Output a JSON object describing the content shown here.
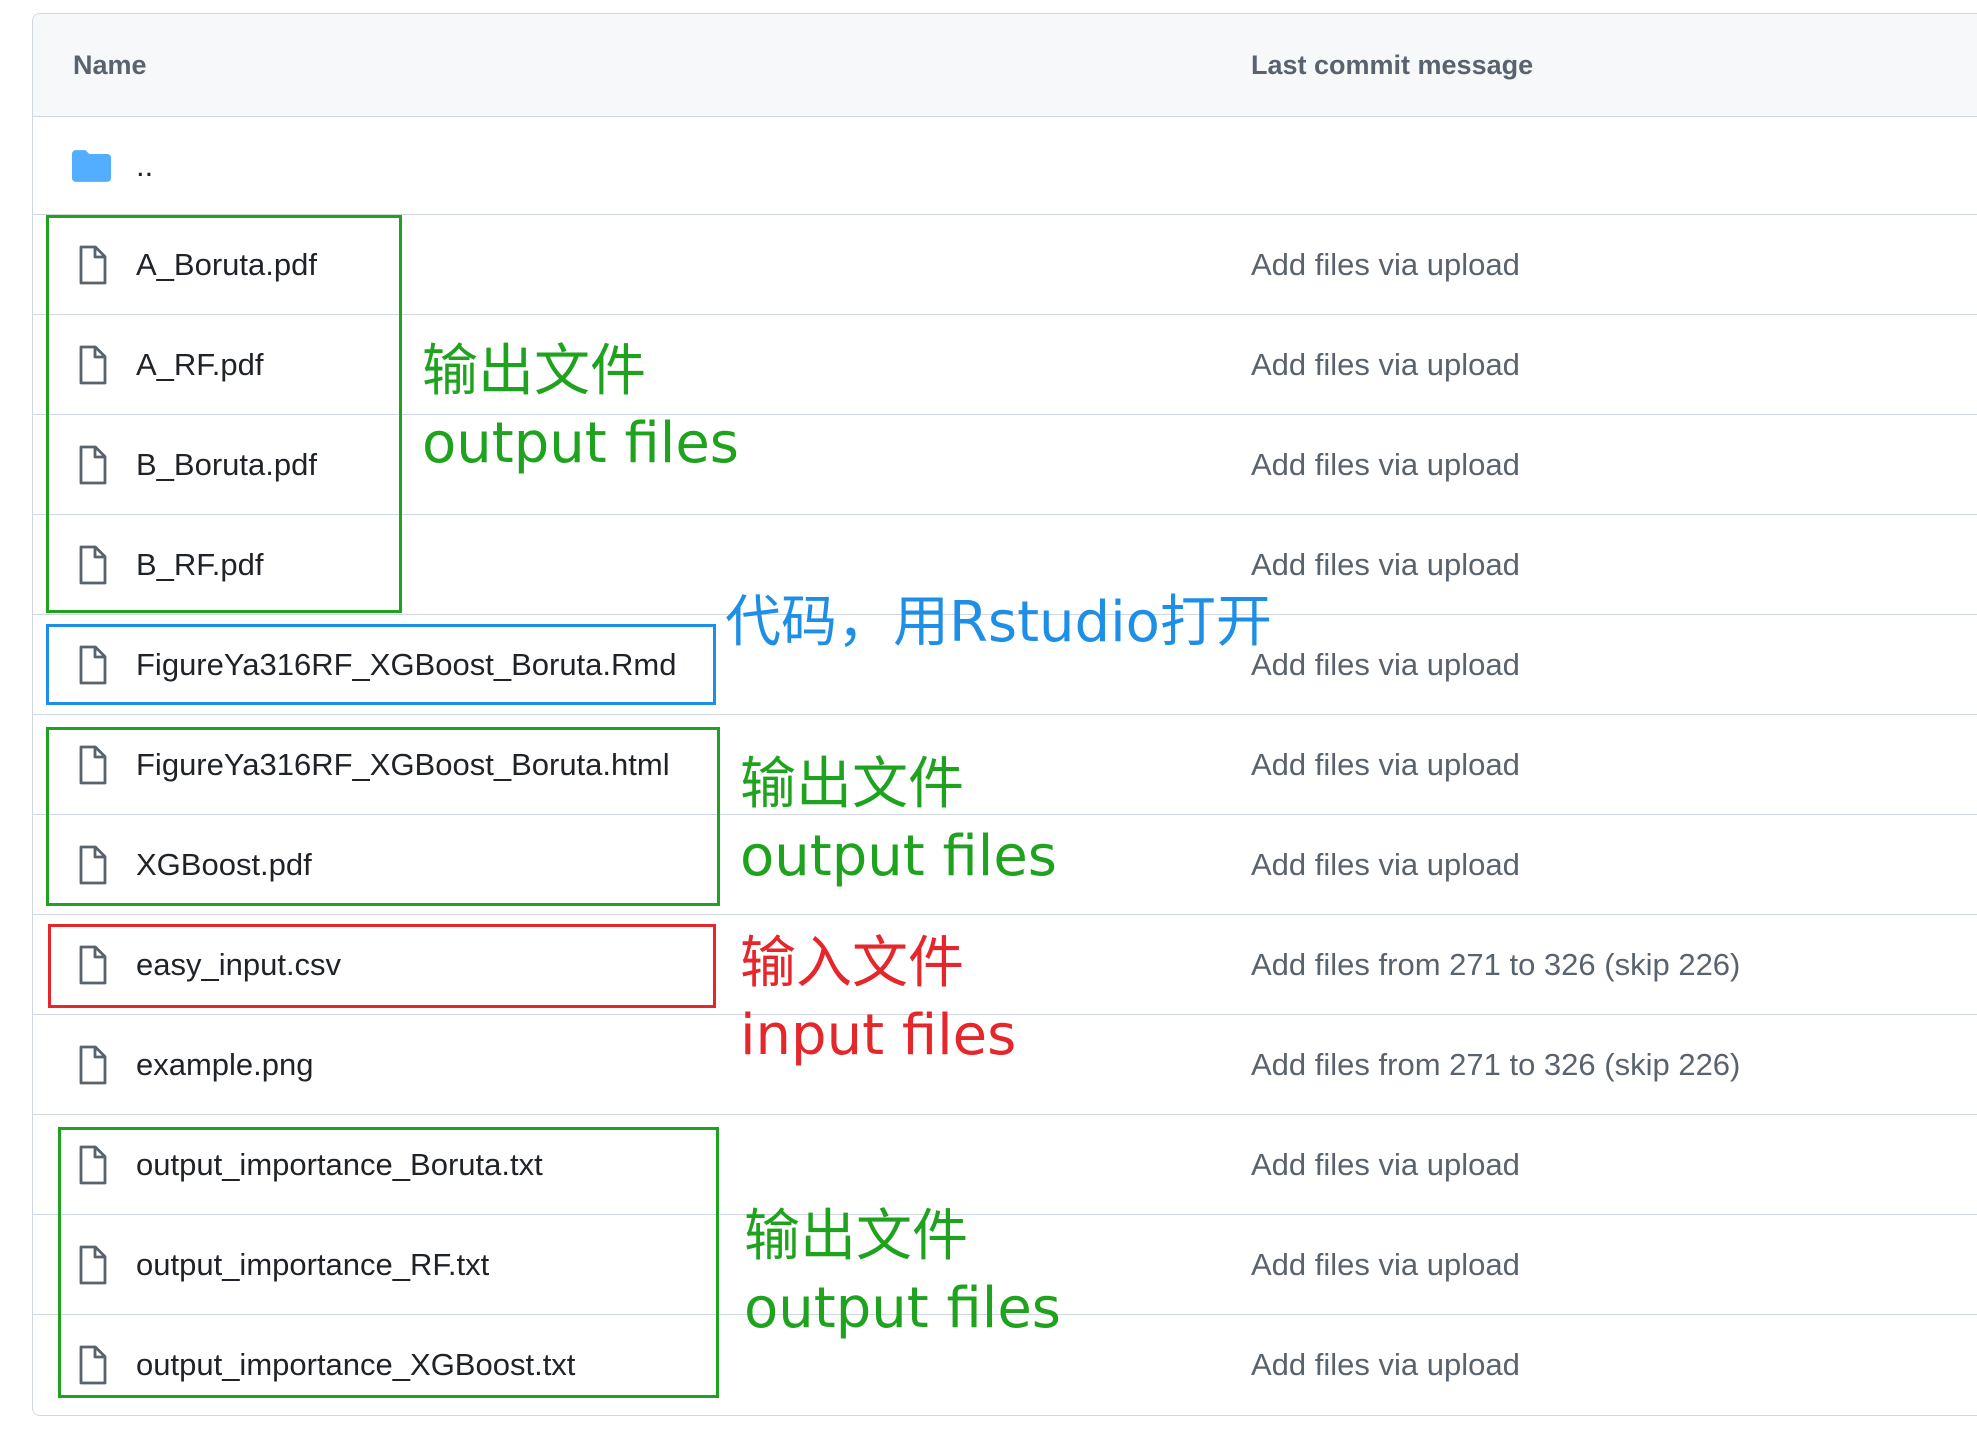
{
  "header": {
    "name_label": "Name",
    "commit_label": "Last commit message"
  },
  "parent_row": {
    "label": ".."
  },
  "files": [
    {
      "name": "A_Boruta.pdf",
      "commit": "Add files via upload"
    },
    {
      "name": "A_RF.pdf",
      "commit": "Add files via upload"
    },
    {
      "name": "B_Boruta.pdf",
      "commit": "Add files via upload"
    },
    {
      "name": "B_RF.pdf",
      "commit": "Add files via upload"
    },
    {
      "name": "FigureYa316RF_XGBoost_Boruta.Rmd",
      "commit": "Add files via upload"
    },
    {
      "name": "FigureYa316RF_XGBoost_Boruta.html",
      "commit": "Add files via upload"
    },
    {
      "name": "XGBoost.pdf",
      "commit": "Add files via upload"
    },
    {
      "name": "easy_input.csv",
      "commit": "Add files from 271 to 326 (skip 226)"
    },
    {
      "name": "example.png",
      "commit": "Add files from 271 to 326 (skip 226)"
    },
    {
      "name": "output_importance_Boruta.txt",
      "commit": "Add files via upload"
    },
    {
      "name": "output_importance_RF.txt",
      "commit": "Add files via upload"
    },
    {
      "name": "output_importance_XGBoost.txt",
      "commit": "Add files via upload"
    }
  ],
  "annotations": {
    "output_group_1": {
      "line1": "输出文件",
      "line2": "output files"
    },
    "code_file": {
      "line1": "代码，用Rstudio打开"
    },
    "output_group_2": {
      "line1": "输出文件",
      "line2": "output files"
    },
    "input_group": {
      "line1": "输入文件",
      "line2": "input files"
    },
    "output_group_3": {
      "line1": "输出文件",
      "line2": "output files"
    }
  },
  "icons": {
    "parent": "folder-icon",
    "file": "file-icon"
  },
  "colors": {
    "output": "#1fa31f",
    "code": "#1e8fe6",
    "input": "#e5262b",
    "folder": "#54aeff",
    "border": "#d0d7de",
    "header-bg": "#f6f8fa"
  }
}
